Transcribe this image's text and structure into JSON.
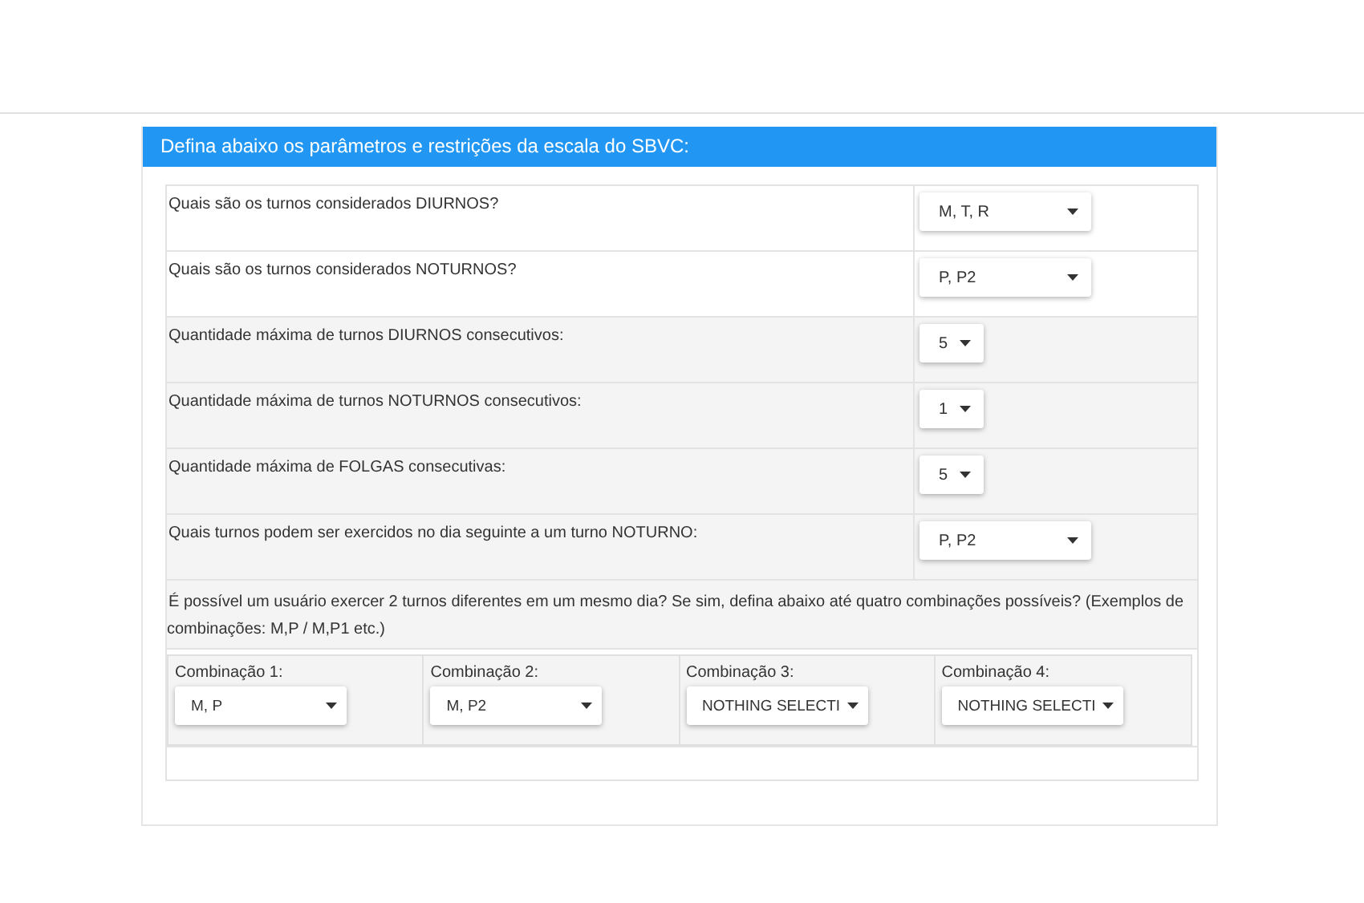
{
  "panel": {
    "title": "Defina abaixo os parâmetros e restrições da escala do SBVC:"
  },
  "rows": [
    {
      "question": "Quais são os turnos considerados DIURNOS?",
      "value": "M, T, R",
      "kind": "wide"
    },
    {
      "question": "Quais são os turnos considerados NOTURNOS?",
      "value": "P, P2",
      "kind": "wide"
    },
    {
      "question": "Quantidade máxima de turnos DIURNOS consecutivos:",
      "value": "5",
      "kind": "narrow"
    },
    {
      "question": "Quantidade máxima de turnos NOTURNOS consecutivos:",
      "value": "1",
      "kind": "narrow"
    },
    {
      "question": "Quantidade máxima de FOLGAS consecutivas:",
      "value": "5",
      "kind": "narrow"
    },
    {
      "question": "Quais turnos podem ser exercidos no dia seguinte a um turno NOTURNO:",
      "value": "P, P2",
      "kind": "wide"
    }
  ],
  "combinations": {
    "question": "É possível um usuário exercer 2 turnos diferentes em um mesmo dia? Se sim, defina abaixo até quatro combinações possíveis? (Exemplos de combinações: M,P / M,P1 etc.)",
    "items": [
      {
        "label": "Combinação 1:",
        "value": "M, P"
      },
      {
        "label": "Combinação 2:",
        "value": "M, P2"
      },
      {
        "label": "Combinação 3:",
        "value": "NOTHING SELECTI"
      },
      {
        "label": "Combinação 4:",
        "value": "NOTHING SELECTI"
      }
    ]
  }
}
